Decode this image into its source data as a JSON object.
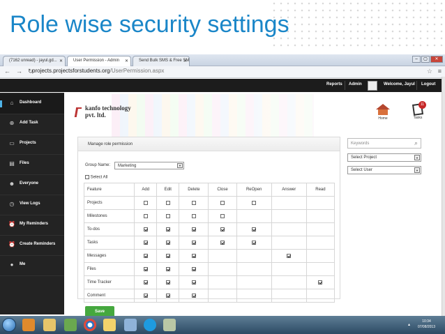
{
  "slide": {
    "title": "Role wise security settings"
  },
  "browser": {
    "tabs": [
      "(7162 unread) - jayul.gd...",
      "User Permission - Admin",
      "Send Bulk SMS & Free SM"
    ],
    "url_host": "projects.projectsforstudents.org",
    "url_path": "/UserPermission.aspx",
    "window_controls": [
      "–",
      "▢",
      "✕"
    ]
  },
  "topnav": {
    "reports": "Reports",
    "admin": "Admin",
    "welcome": "Welcome, Jayul",
    "logout": "Logout"
  },
  "sidebar": {
    "items": [
      {
        "label": "Dashboard",
        "icon": "home-icon"
      },
      {
        "label": "Add Task",
        "icon": "add-task-icon"
      },
      {
        "label": "Projects",
        "icon": "projects-icon"
      },
      {
        "label": "Files",
        "icon": "files-icon"
      },
      {
        "label": "Everyone",
        "icon": "people-icon"
      },
      {
        "label": "View Logs",
        "icon": "clock-icon"
      },
      {
        "label": "My Reminders",
        "icon": "alarm-icon"
      },
      {
        "label": "Create Reminders",
        "icon": "alarm-plus-icon"
      },
      {
        "label": "Me",
        "icon": "user-icon"
      }
    ]
  },
  "logo": {
    "line1": "kanfo technology",
    "line2": "pvt. ltd."
  },
  "shortcuts": {
    "home": "Home",
    "tasks": "Tasks",
    "tasks_badge": "11"
  },
  "panel": {
    "title": "Manage role permission",
    "group_label": "Group Name:",
    "group_value": "Marketing",
    "select_all": "Select All",
    "columns": [
      "Feature",
      "Add",
      "Edit",
      "Delete",
      "Close",
      "ReOpen",
      "Answer",
      "Read"
    ],
    "rows": [
      {
        "feature": "Projects",
        "cells": [
          "cb",
          "cb",
          "cb",
          "cb",
          "cb",
          "",
          ""
        ]
      },
      {
        "feature": "Milestones",
        "cells": [
          "cb",
          "cb",
          "cb",
          "cb",
          "",
          "",
          ""
        ]
      },
      {
        "feature": "To-dos",
        "cells": [
          "on",
          "on",
          "on",
          "on",
          "on",
          "",
          ""
        ]
      },
      {
        "feature": "Tasks",
        "cells": [
          "on",
          "on",
          "on",
          "on",
          "on",
          "",
          ""
        ]
      },
      {
        "feature": "Messages",
        "cells": [
          "on",
          "on",
          "on",
          "",
          "",
          "on",
          ""
        ]
      },
      {
        "feature": "Files",
        "cells": [
          "on",
          "on",
          "on",
          "",
          "",
          "",
          ""
        ]
      },
      {
        "feature": "Time Tracker",
        "cells": [
          "on",
          "on",
          "on",
          "",
          "",
          "",
          "on"
        ]
      },
      {
        "feature": "Comment",
        "cells": [
          "on",
          "on",
          "on",
          "",
          "",
          "",
          ""
        ]
      }
    ],
    "save": "Save"
  },
  "filters": {
    "keywords_placeholder": "Keywords",
    "project": "Select Project",
    "user": "Select User"
  },
  "taskbar": {
    "time": "10:34",
    "date": "07/08/2013"
  },
  "colors": {
    "title_blue": "#1a86c8",
    "nav_dark": "#1c1c1c",
    "save_green": "#45a83e",
    "accent_red": "#c62828"
  }
}
